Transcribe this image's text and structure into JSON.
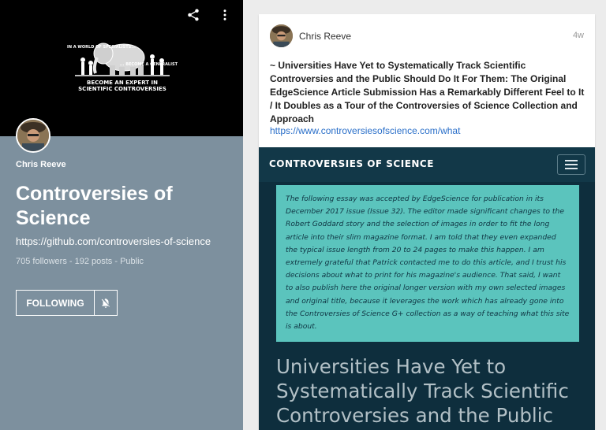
{
  "collection": {
    "owner_name": "Chris Reeve",
    "title": "Controversies of Science",
    "url": "https://github.com/controversies-of-science",
    "meta": "705 followers - 192 posts - Public",
    "follow_label": "FOLLOWING",
    "cover_art": {
      "left_tag": "IN A WORLD OF SPECIALISTS...",
      "right_tag": "... BECOME A GENERALIST",
      "headline": "BECOME AN EXPERT IN SCIENTIFIC CONTROVERSIES"
    },
    "icons": [
      "share-icon",
      "more-vert-icon",
      "bell-off-icon"
    ]
  },
  "post": {
    "author": "Chris Reeve",
    "time": "4w",
    "text": "~ Universities Have Yet to Systematically Track Scientific Controversies and the Public Should Do It For Them: The Original EdgeScience Article Submission Has a Remarkably Different Feel to It / It Doubles as a Tour of the Controversies of Science Collection and Approach",
    "link": "https://www.controversiesofscience.com/what"
  },
  "preview": {
    "brand": "CONTROVERSIES OF SCIENCE",
    "note": "The following essay was accepted by EdgeScience for publication in its December 2017 issue (Issue 32). The editor made significant changes to the Robert Goddard story and the selection of images in order to fit the long article into their slim magazine format. I am told that they even expanded the typical issue length from 20 to 24 pages to make this happen. I am extremely grateful that Patrick contacted me to do this article, and I trust his decisions about what to print for his magazine's audience. That said, I want to also publish here the original longer version with my own selected images and original title, because it leverages the work which has already gone into the Controversies of Science G+ collection as a way of teaching what this site is about.",
    "heading": "Universities Have Yet to Systematically Track Scientific Controversies and the Public"
  },
  "colors": {
    "panel": "#7d909e",
    "cover": "#000000",
    "preview_bg": "#0e2e3d",
    "note_bg": "#5bc4bd",
    "link": "#2a6fc9"
  }
}
